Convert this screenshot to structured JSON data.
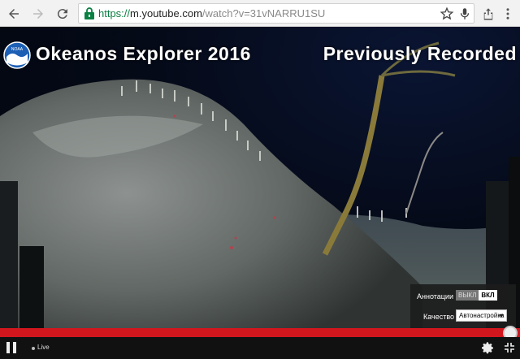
{
  "browser": {
    "url_scheme": "https://",
    "url_host": "m.youtube.com",
    "url_path": "/watch?v=31vNARRU1SU",
    "icons": {
      "back": "back-arrow-icon",
      "forward": "forward-arrow-icon",
      "reload": "reload-icon",
      "lock": "lock-icon",
      "bookmark": "star-icon",
      "voice": "microphone-icon",
      "share": "share-icon",
      "menu": "more-vert-icon"
    }
  },
  "video": {
    "title_left": "Okeanos Explorer 2016",
    "title_right": "Previously Recorded",
    "logo_text": "NOAA"
  },
  "settings_panel": {
    "annotations_label": "Аннотации",
    "annotations_off": "ВЫКЛ",
    "annotations_on": "ВКЛ",
    "quality_label": "Качество",
    "quality_value": "Автонастройка"
  },
  "player": {
    "live_label": "Live",
    "progress_fraction": 1.0,
    "colors": {
      "progress": "#d2161e",
      "controls_bg": "#111111"
    }
  }
}
